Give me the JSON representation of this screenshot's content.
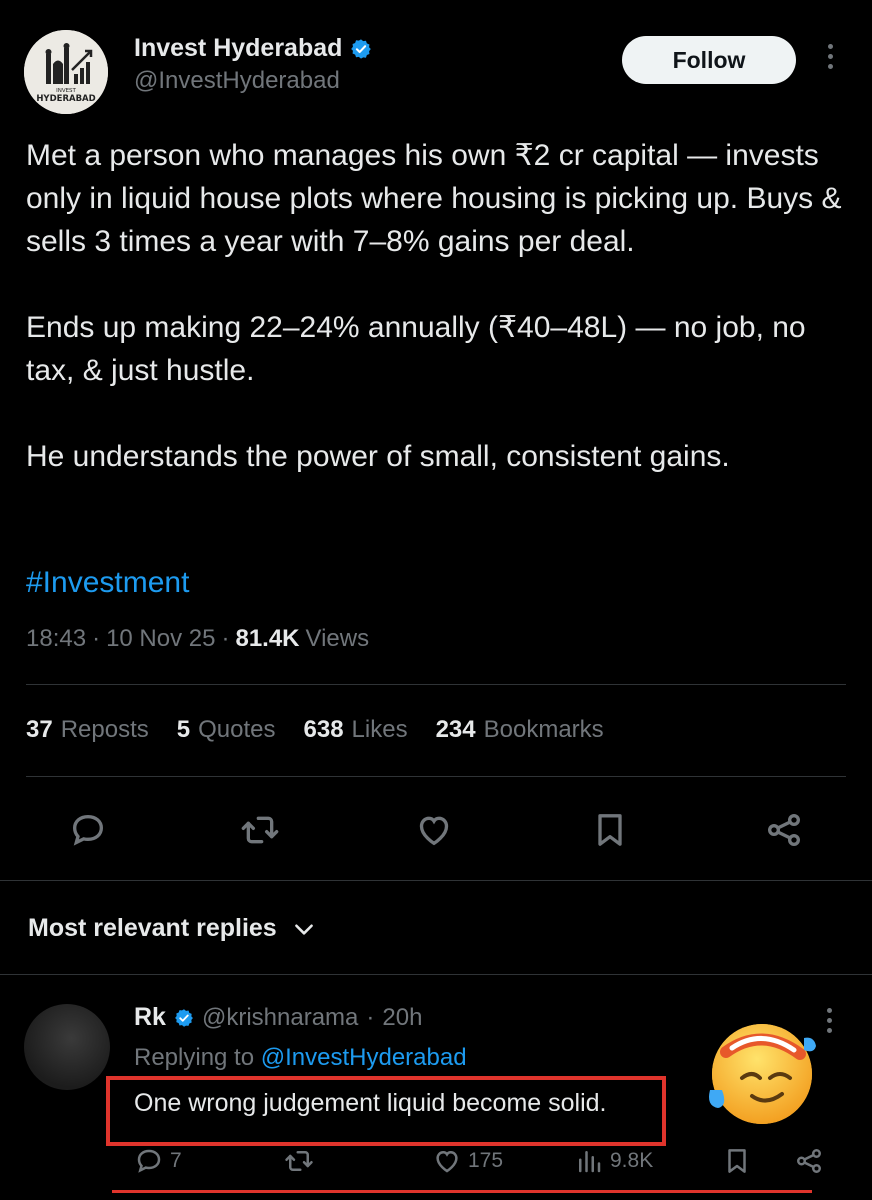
{
  "author": {
    "name": "Invest Hyderabad",
    "handle": "@InvestHyderabad",
    "verified": true,
    "avatar_text_top": "INVEST",
    "avatar_text_bottom": "HYDERABAD"
  },
  "follow_label": "Follow",
  "tweet": {
    "paragraphs": [
      "Met a person who manages his own ₹2 cr capital — invests only in liquid house plots where housing is picking up. Buys & sells 3 times a year with 7–8% gains per deal.",
      "Ends up making 22–24% annually (₹40–48L) — no job, no tax, & just hustle.",
      "He understands the power of small, consistent gains."
    ],
    "hashtag": "#Investment",
    "time": "18:43",
    "date": "10 Nov 25",
    "views_count": "81.4K",
    "views_label": "Views"
  },
  "stats": [
    {
      "count": "37",
      "label": "Reposts"
    },
    {
      "count": "5",
      "label": "Quotes"
    },
    {
      "count": "638",
      "label": "Likes"
    },
    {
      "count": "234",
      "label": "Bookmarks"
    }
  ],
  "actions": [
    "reply-icon",
    "repost-icon",
    "like-icon",
    "bookmark-icon",
    "share-icon"
  ],
  "replies_sort_label": "Most relevant replies",
  "reply": {
    "name": "Rk",
    "verified": true,
    "handle": "@krishnarama",
    "time": "20h",
    "replying_prefix": "Replying to",
    "replying_to": "@InvestHyderabad",
    "text": "One wrong judgement liquid become solid.",
    "reply_count": "7",
    "like_count": "175",
    "view_count": "9.8K"
  },
  "colors": {
    "background": "#000000",
    "text": "#e7e9ea",
    "muted": "#71767b",
    "accent": "#1d9bf0",
    "highlight_box": "#e0342c"
  }
}
